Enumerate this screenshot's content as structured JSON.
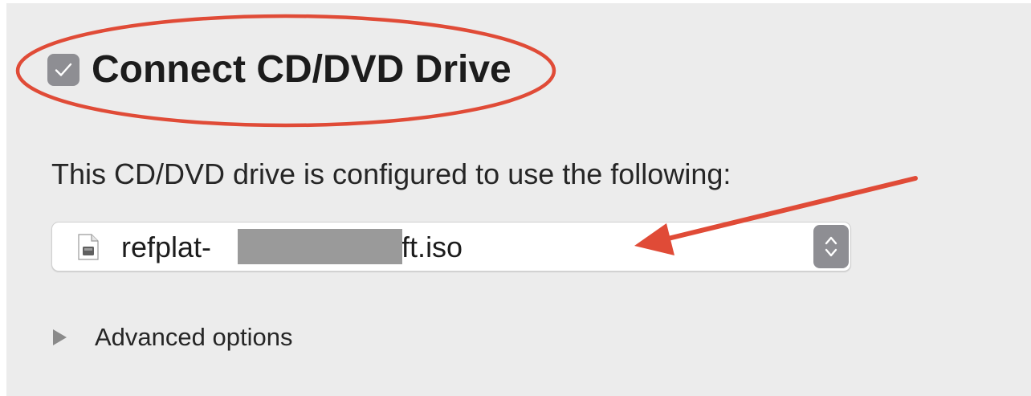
{
  "header": {
    "checkbox_checked": true,
    "title": "Connect CD/DVD Drive"
  },
  "description": "This CD/DVD drive is configured to use the following:",
  "media_select": {
    "value_prefix": "refplat-",
    "value_suffix": "-eft.iso",
    "icon": "disk-image-file-icon",
    "value_partially_redacted": true
  },
  "advanced": {
    "label": "Advanced options",
    "expanded": false
  },
  "annotations": {
    "ellipse_color": "#e04b37",
    "arrow_color": "#e04b37"
  },
  "colors": {
    "panel_background": "#ececec",
    "control_gray": "#8e8e93",
    "redaction_gray": "#9a9a9a"
  }
}
